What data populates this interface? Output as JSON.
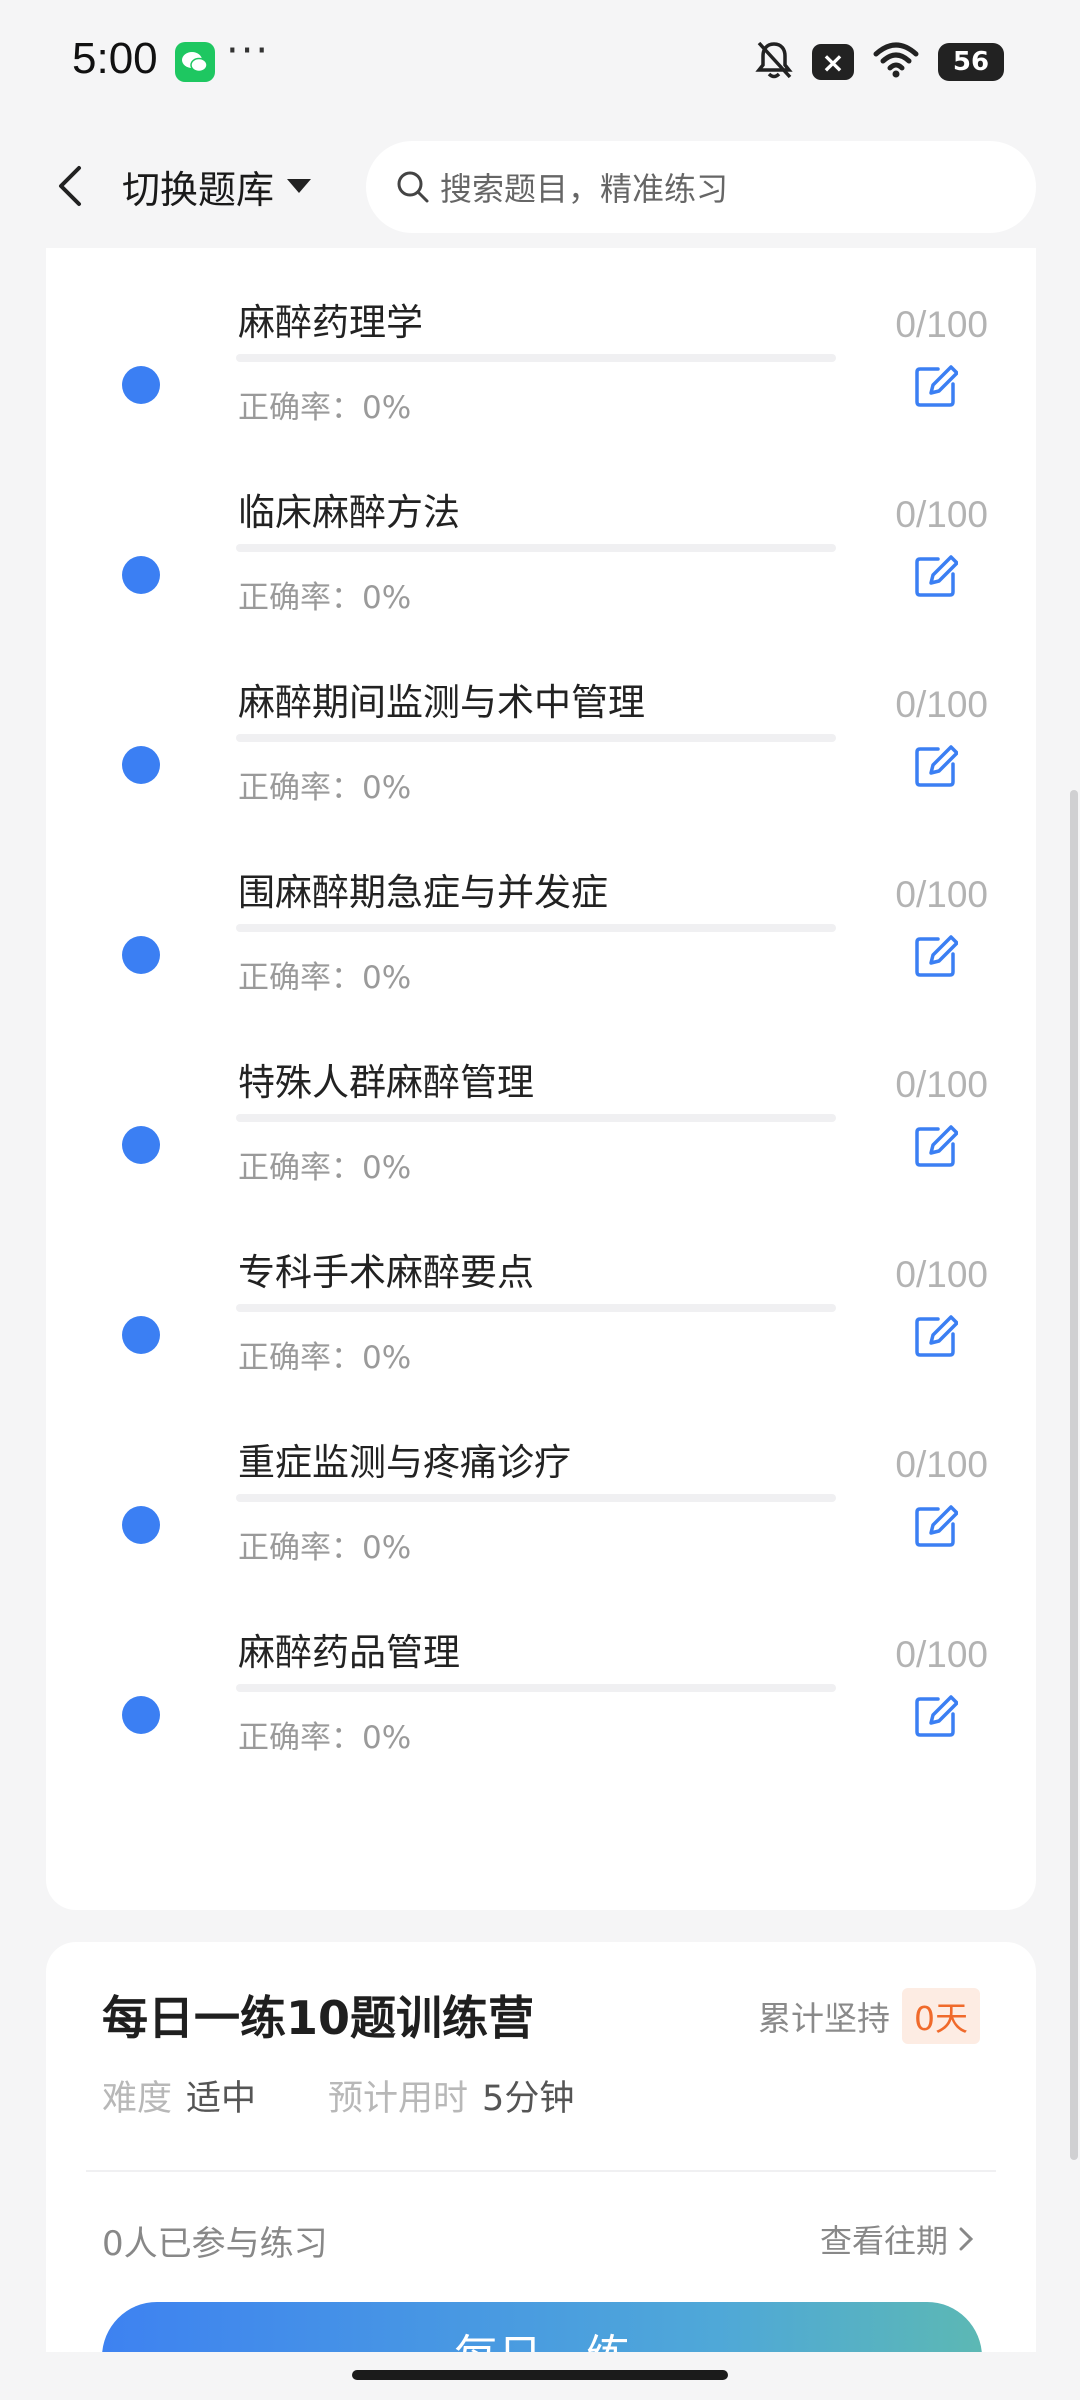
{
  "status_bar": {
    "time": "5:00",
    "dots": "···",
    "notification_badge": "×",
    "battery": "56",
    "icons": [
      "wechat-icon",
      "mute-bell-icon",
      "close-badge-icon",
      "wifi-icon",
      "battery-icon"
    ]
  },
  "nav": {
    "switch_label": "切换题库",
    "search_placeholder": "搜索题目，精准练习",
    "icons": [
      "back-arrow-icon",
      "caret-down-icon",
      "search-icon"
    ]
  },
  "chapters": [
    {
      "title": "",
      "count": "",
      "accuracy": "正确率：0%"
    },
    {
      "title": "麻醉药理学",
      "count": "0/100",
      "accuracy": "正确率：0%"
    },
    {
      "title": "临床麻醉方法",
      "count": "0/100",
      "accuracy": "正确率：0%"
    },
    {
      "title": "麻醉期间监测与术中管理",
      "count": "0/100",
      "accuracy": "正确率：0%"
    },
    {
      "title": "围麻醉期急症与并发症",
      "count": "0/100",
      "accuracy": "正确率：0%"
    },
    {
      "title": "特殊人群麻醉管理",
      "count": "0/100",
      "accuracy": "正确率：0%"
    },
    {
      "title": "专科手术麻醉要点",
      "count": "0/100",
      "accuracy": "正确率：0%"
    },
    {
      "title": "重症监测与疼痛诊疗",
      "count": "0/100",
      "accuracy": "正确率：0%"
    },
    {
      "title": "麻醉药品管理",
      "count": "0/100",
      "accuracy": "正确率：0%"
    }
  ],
  "training": {
    "title": "每日一练10题训练营",
    "streak_label": "累计坚持",
    "streak_value": "0天",
    "difficulty_label": "难度",
    "difficulty_value": "适中",
    "time_label": "预计用时",
    "time_value": "5分钟",
    "participants": "0人已参与练习",
    "past_link": "查看往期",
    "start_button": "每日一练"
  },
  "colors": {
    "accent_blue": "#3b7ff3",
    "streak_orange": "#f06a2b",
    "background": "#f5f5f6"
  }
}
